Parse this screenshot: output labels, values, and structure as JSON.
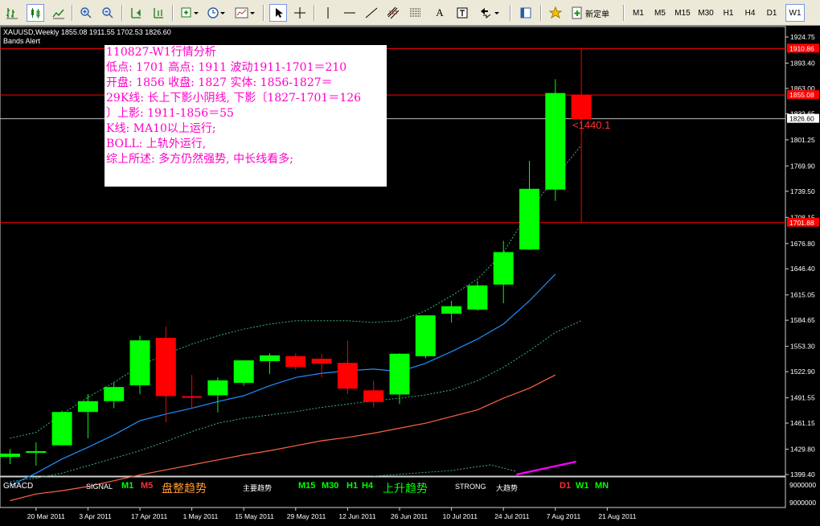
{
  "header": {
    "symbol_line": "XAUUSD,Weekly  1855.08 1911.55 1702.53 1826.60",
    "indicator_name": "Bands Alert"
  },
  "toolbar": {
    "new_order_label": "新定单",
    "timeframes": [
      "M1",
      "M5",
      "M15",
      "M30",
      "H1",
      "H4",
      "D1",
      "W1"
    ],
    "active_timeframe": "W1",
    "icons": [
      "bar-chart-icon",
      "candlestick-chart-icon",
      "line-chart-icon",
      "zoom-in-icon",
      "zoom-out-icon",
      "tile-icon",
      "autoscroll-icon",
      "indicators-icon",
      "periods-icon",
      "templates-icon",
      "cursor-icon",
      "crosshair-icon",
      "vertical-line-icon",
      "horizontal-line-icon",
      "trendline-icon",
      "fibonacci-icon",
      "channel-icon",
      "text-icon",
      "text-label-icon",
      "arrows-icon",
      "navigator-icon",
      "expert-icon",
      "new-order-icon"
    ]
  },
  "analysis": {
    "lines": [
      "110827-W1行情分析",
      "低点: 1701  高点: 1911  波动1911-1701＝210",
      "开盘: 1856  收盘: 1827  实体: 1856-1827＝",
      "29K线: 长上下影小阴线, 下影〔1827-1701＝126",
      "〕上影: 1911-1856＝55",
      "K线: MA10以上运行;",
      "BOLL: 上轨外运行,",
      "综上所述: 多方仍然强势, 中长线看多;"
    ]
  },
  "annotation": "<1440.1",
  "price_axis": {
    "ticks": [
      "1924.75",
      "1893.40",
      "1863.00",
      "1832.65",
      "1801.25",
      "1769.90",
      "1739.50",
      "1708.15",
      "1676.80",
      "1646.40",
      "1615.05",
      "1584.65",
      "1553.30",
      "1522.90",
      "1491.55",
      "1461.15",
      "1429.80",
      "1399.40"
    ],
    "level_labels": [
      "1910.86",
      "1855.08",
      "1826.60",
      "1701.88"
    ]
  },
  "date_axis": [
    "20 Mar 2011",
    "3 Apr 2011",
    "17 Apr 2011",
    "1 May 2011",
    "15 May 2011",
    "29 May 2011",
    "12 Jun 2011",
    "26 Jun 2011",
    "10 Jul 2011",
    "24 Jul 2011",
    "7 Aug 2011",
    "21 Aug 2011"
  ],
  "subwindow": {
    "name": "GMACD",
    "signal_label": "SIGNAL",
    "m1": "M1",
    "m5": "M5",
    "consolidation_label": "盘整趋势",
    "main_trend_label": "主要趋势",
    "m15": "M15",
    "m30": "M30",
    "h1": "H1",
    "h4": "H4",
    "uptrend_label": "上升趋势",
    "strong_label": "STRONG",
    "big_trend_label": "大趋势",
    "d1": "D1",
    "w1": "W1",
    "mn": "MN",
    "axis_top": "9000000",
    "axis_bottom": "9000000"
  },
  "colors": {
    "bull": "#00ff00",
    "bear": "#ff0000",
    "ma": "#1e90ff",
    "boll": "#2e8b57",
    "lower": "#ff6347",
    "gmacd": "#ff00ff",
    "analysis_text": "#ff00c8"
  },
  "chart_data": {
    "type": "candlestick",
    "symbol": "XAUUSD",
    "timeframe": "Weekly",
    "candles": [
      {
        "week": "2011-03-13",
        "open": 1421,
        "high": 1430,
        "low": 1412,
        "close": 1424
      },
      {
        "week": "2011-03-20",
        "open": 1426,
        "high": 1438,
        "low": 1410,
        "close": 1427
      },
      {
        "week": "2011-03-27",
        "open": 1435,
        "high": 1476,
        "low": 1435,
        "close": 1474
      },
      {
        "week": "2011-04-03",
        "open": 1475,
        "high": 1496,
        "low": 1443,
        "close": 1487
      },
      {
        "week": "2011-04-10",
        "open": 1488,
        "high": 1510,
        "low": 1479,
        "close": 1504
      },
      {
        "week": "2011-04-17",
        "open": 1507,
        "high": 1566,
        "low": 1496,
        "close": 1560
      },
      {
        "week": "2011-04-24",
        "open": 1563,
        "high": 1577,
        "low": 1462,
        "close": 1494
      },
      {
        "week": "2011-05-01",
        "open": 1493,
        "high": 1519,
        "low": 1479,
        "close": 1492
      },
      {
        "week": "2011-05-08",
        "open": 1495,
        "high": 1516,
        "low": 1474,
        "close": 1512
      },
      {
        "week": "2011-05-15",
        "open": 1510,
        "high": 1536,
        "low": 1506,
        "close": 1536
      },
      {
        "week": "2011-05-22",
        "open": 1536,
        "high": 1545,
        "low": 1520,
        "close": 1542
      },
      {
        "week": "2011-05-29",
        "open": 1541,
        "high": 1545,
        "low": 1525,
        "close": 1529
      },
      {
        "week": "2011-06-05",
        "open": 1538,
        "high": 1544,
        "low": 1516,
        "close": 1533
      },
      {
        "week": "2011-06-12",
        "open": 1533,
        "high": 1560,
        "low": 1496,
        "close": 1503
      },
      {
        "week": "2011-06-19",
        "open": 1500,
        "high": 1512,
        "low": 1480,
        "close": 1487
      },
      {
        "week": "2011-06-26",
        "open": 1496,
        "high": 1545,
        "low": 1484,
        "close": 1544
      },
      {
        "week": "2011-07-03",
        "open": 1542,
        "high": 1590,
        "low": 1539,
        "close": 1590
      },
      {
        "week": "2011-07-10",
        "open": 1593,
        "high": 1608,
        "low": 1582,
        "close": 1601
      },
      {
        "week": "2011-07-17",
        "open": 1598,
        "high": 1632,
        "low": 1596,
        "close": 1626
      },
      {
        "week": "2011-07-24",
        "open": 1628,
        "high": 1680,
        "low": 1605,
        "close": 1666
      },
      {
        "week": "2011-07-31",
        "open": 1670,
        "high": 1776,
        "low": 1669,
        "close": 1742
      },
      {
        "week": "2011-08-07",
        "open": 1742,
        "high": 1874,
        "low": 1728,
        "close": 1857
      },
      {
        "week": "2011-08-14",
        "open": 1855.08,
        "high": 1911.55,
        "low": 1702.53,
        "close": 1826.6
      }
    ],
    "ma_blue": [
      1386,
      1401,
      1418,
      1432,
      1447,
      1464,
      1472,
      1479,
      1487,
      1494,
      1506,
      1516,
      1521,
      1524,
      1526,
      1523,
      1533,
      1547,
      1562,
      1580,
      1608,
      1640
    ],
    "boll_upper": [
      1443,
      1450,
      1472,
      1492,
      1510,
      1530,
      1544,
      1556,
      1566,
      1574,
      1580,
      1584,
      1584,
      1584,
      1582,
      1584,
      1596,
      1614,
      1634,
      1666,
      1716,
      1756,
      1795
    ],
    "boll_lower": [
      1391,
      1395,
      1401,
      1410,
      1419,
      1428,
      1439,
      1451,
      1461,
      1467,
      1471,
      1475,
      1480,
      1484,
      1488,
      1491,
      1495,
      1501,
      1512,
      1528,
      1548,
      1570,
      1584
    ],
    "orange_line": [
      1368,
      1376,
      1380,
      1385,
      1392,
      1399,
      1405,
      1411,
      1417,
      1423,
      1428,
      1434,
      1440,
      1444,
      1449,
      1455,
      1461,
      1469,
      1477,
      1491,
      1503,
      1519
    ],
    "y_range": [
      1399.4,
      1924.75
    ]
  }
}
